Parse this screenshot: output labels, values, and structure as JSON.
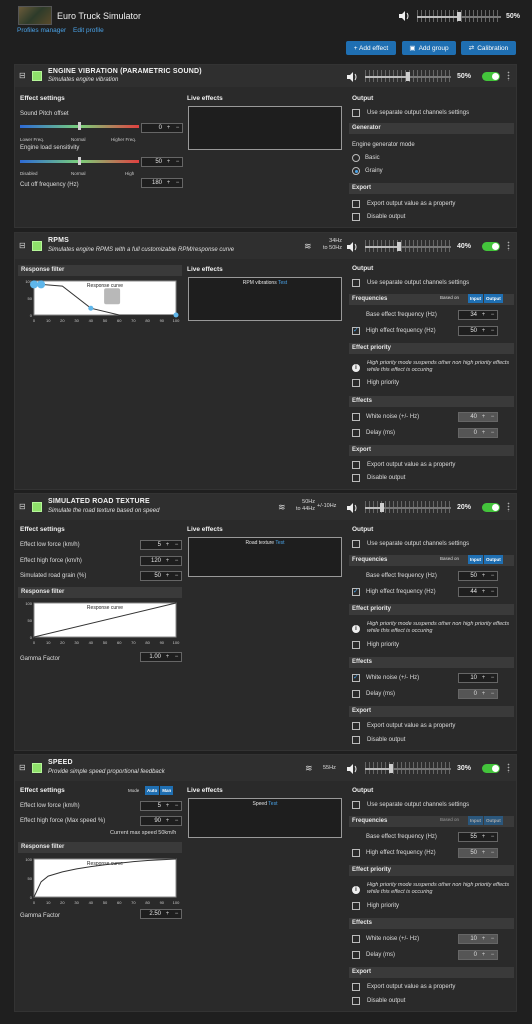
{
  "app": {
    "title": "Euro Truck Simulator",
    "links": [
      "Profiles manager",
      "Edit profile"
    ],
    "master_volume": "50%",
    "master_volume_value": 0.5
  },
  "toolbar": {
    "add_effect": "+ Add effect",
    "add_group": "Add group",
    "calibration": "Calibration"
  },
  "common": {
    "effect_settings": "Effect settings",
    "live_effects": "Live effects",
    "output": "Output",
    "use_separate": "Use separate output channels settings",
    "export": "Export",
    "export_value": "Export output value as a property",
    "disable_output": "Disable output",
    "response_filter": "Response filter",
    "response_curve": "Response curve",
    "frequencies": "Frequencies",
    "based_on": "Based on",
    "input": "Input",
    "output_btn": "Output",
    "base_freq": "Base effect frequency (Hz)",
    "high_freq": "High effect frequency (Hz)",
    "effect_priority": "Effect priority",
    "priority_note": "High priority mode suspends other non high priority effects while this effect is occuring",
    "high_priority": "High priority",
    "effects": "Effects",
    "white_noise": "White noise (+/- Hz)",
    "delay": "Delay (ms)",
    "gamma": "Gamma Factor",
    "test": "Test"
  },
  "engine": {
    "title": "ENGINE VIBRATION (PARAMETRIC SOUND)",
    "subtitle": "Simulates engine vibration",
    "volume": "50%",
    "volume_value": 0.5,
    "pitch_label": "Sound Pitch offset",
    "pitch_value": "0",
    "pitch_ticks": [
      "Lower Freq.",
      "Normal",
      "Higher Freq."
    ],
    "load_label": "Engine load sensitivity",
    "load_value": "50",
    "load_ticks": [
      "Disabled",
      "Normal",
      "High"
    ],
    "cutoff_label": "Cut off frequency (Hz)",
    "cutoff_value": "180",
    "generator": "Generator",
    "gen_mode": "Engine generator mode",
    "basic": "Basic",
    "grainy": "Grainy"
  },
  "rpms": {
    "title": "RPMS",
    "subtitle": "Simulates engine RPMS with a full customizable RPM/response curve",
    "freq_a": "34Hz",
    "freq_b": "to 50Hz",
    "volume": "40%",
    "volume_value": 0.4,
    "live_label": "RPM vibrations",
    "base": "34",
    "high": "50",
    "noise": "40",
    "delay": "0"
  },
  "road": {
    "title": "SIMULATED ROAD TEXTURE",
    "subtitle": "Simulate the road texture based on speed",
    "freq_a": "50Hz",
    "freq_b": "to 44Hz",
    "freq_extra": "+/-10Hz",
    "volume": "20%",
    "volume_value": 0.2,
    "low_label": "Effect low force (km/h)",
    "low_value": "5",
    "high_label": "Effect high force (km/h)",
    "high_value": "120",
    "grain_label": "Simulated road grain (%)",
    "grain_value": "50",
    "gamma_value": "1.00",
    "live_label": "Road texture",
    "base": "50",
    "high": "44",
    "noise": "10",
    "delay": "0"
  },
  "speed": {
    "title": "SPEED",
    "subtitle": "Provide simple speed proportional feedback",
    "freq_a": "55Hz",
    "volume": "30%",
    "volume_value": 0.3,
    "mode": "Mode",
    "auto": "Auto",
    "man": "Man",
    "low_label": "Effect low force (km/h)",
    "low_value": "5",
    "high_label": "Effect high force (Max speed %)",
    "high_value": "90",
    "current_max": "Current max speed 50km/h",
    "gamma_value": "2.50",
    "live_label": "Speed",
    "base": "55",
    "high": "50",
    "noise": "10",
    "delay": "0"
  },
  "axis": {
    "y": [
      "100",
      "50",
      "0"
    ],
    "x": [
      "0",
      "10",
      "20",
      "30",
      "40",
      "50",
      "60",
      "70",
      "80",
      "90",
      "100"
    ]
  },
  "curves": {
    "rpms": {
      "x": [
        0,
        5,
        20,
        40,
        60,
        80,
        100
      ],
      "y": [
        90,
        90,
        85,
        20,
        0,
        0,
        0
      ]
    },
    "road": {
      "x": [
        0,
        100
      ],
      "y": [
        0,
        100
      ]
    },
    "speed": {
      "x": [
        0,
        5,
        10,
        20,
        30,
        40,
        50,
        60,
        70,
        80,
        90,
        100
      ],
      "y": [
        0,
        40,
        55,
        66,
        74,
        80,
        85,
        89,
        93,
        96,
        98,
        100
      ]
    }
  }
}
